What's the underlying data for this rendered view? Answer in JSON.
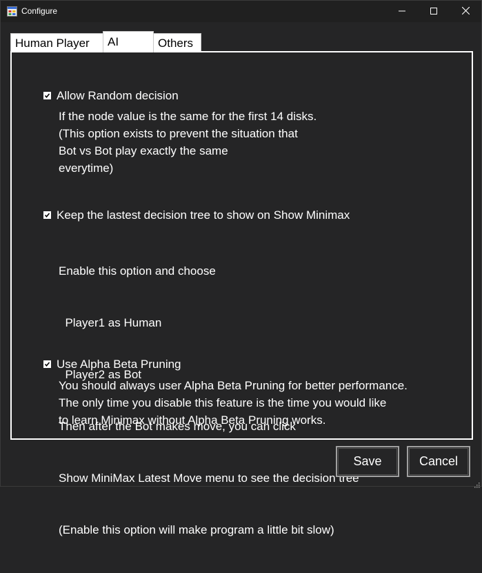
{
  "window": {
    "title": "Configure",
    "icon": "app-window-icon",
    "controls": {
      "minimize": "—",
      "maximize": "☐",
      "close": "✕"
    }
  },
  "tabs": [
    {
      "label": "Human Player",
      "active": false
    },
    {
      "label": "AI",
      "active": true
    },
    {
      "label": "Others",
      "active": false
    }
  ],
  "options": [
    {
      "label": "Allow Random decision",
      "checked": true,
      "description": [
        "If the node value is the same for the first 14 disks.",
        "(This option exists to prevent the situation that",
        "Bot vs Bot play exactly the same",
        "everytime)"
      ]
    },
    {
      "label": "Keep the lastest decision tree to show on Show Minimax",
      "checked": true,
      "description": [
        "Enable this option and choose",
        "  Player1 as Human",
        "  Player2 as Bot",
        "Then after the Bot makes move, you can click",
        "Show MiniMax Latest Move menu to see the decision tree",
        "(Enable this option will make program a little bit slow)"
      ]
    },
    {
      "label": "Use Alpha Beta Pruning",
      "checked": true,
      "description": [
        "You should always user Alpha Beta Pruning for better performance.",
        "The only time you disable this feature is the time you would like",
        "to learn Minimax without Alpha Beta Pruning works."
      ]
    }
  ],
  "buttons": {
    "save": "Save",
    "cancel": "Cancel"
  },
  "colors": {
    "background": "#252526",
    "titlebar": "#202020",
    "text": "#ffffff",
    "tab": "#ffffff"
  }
}
